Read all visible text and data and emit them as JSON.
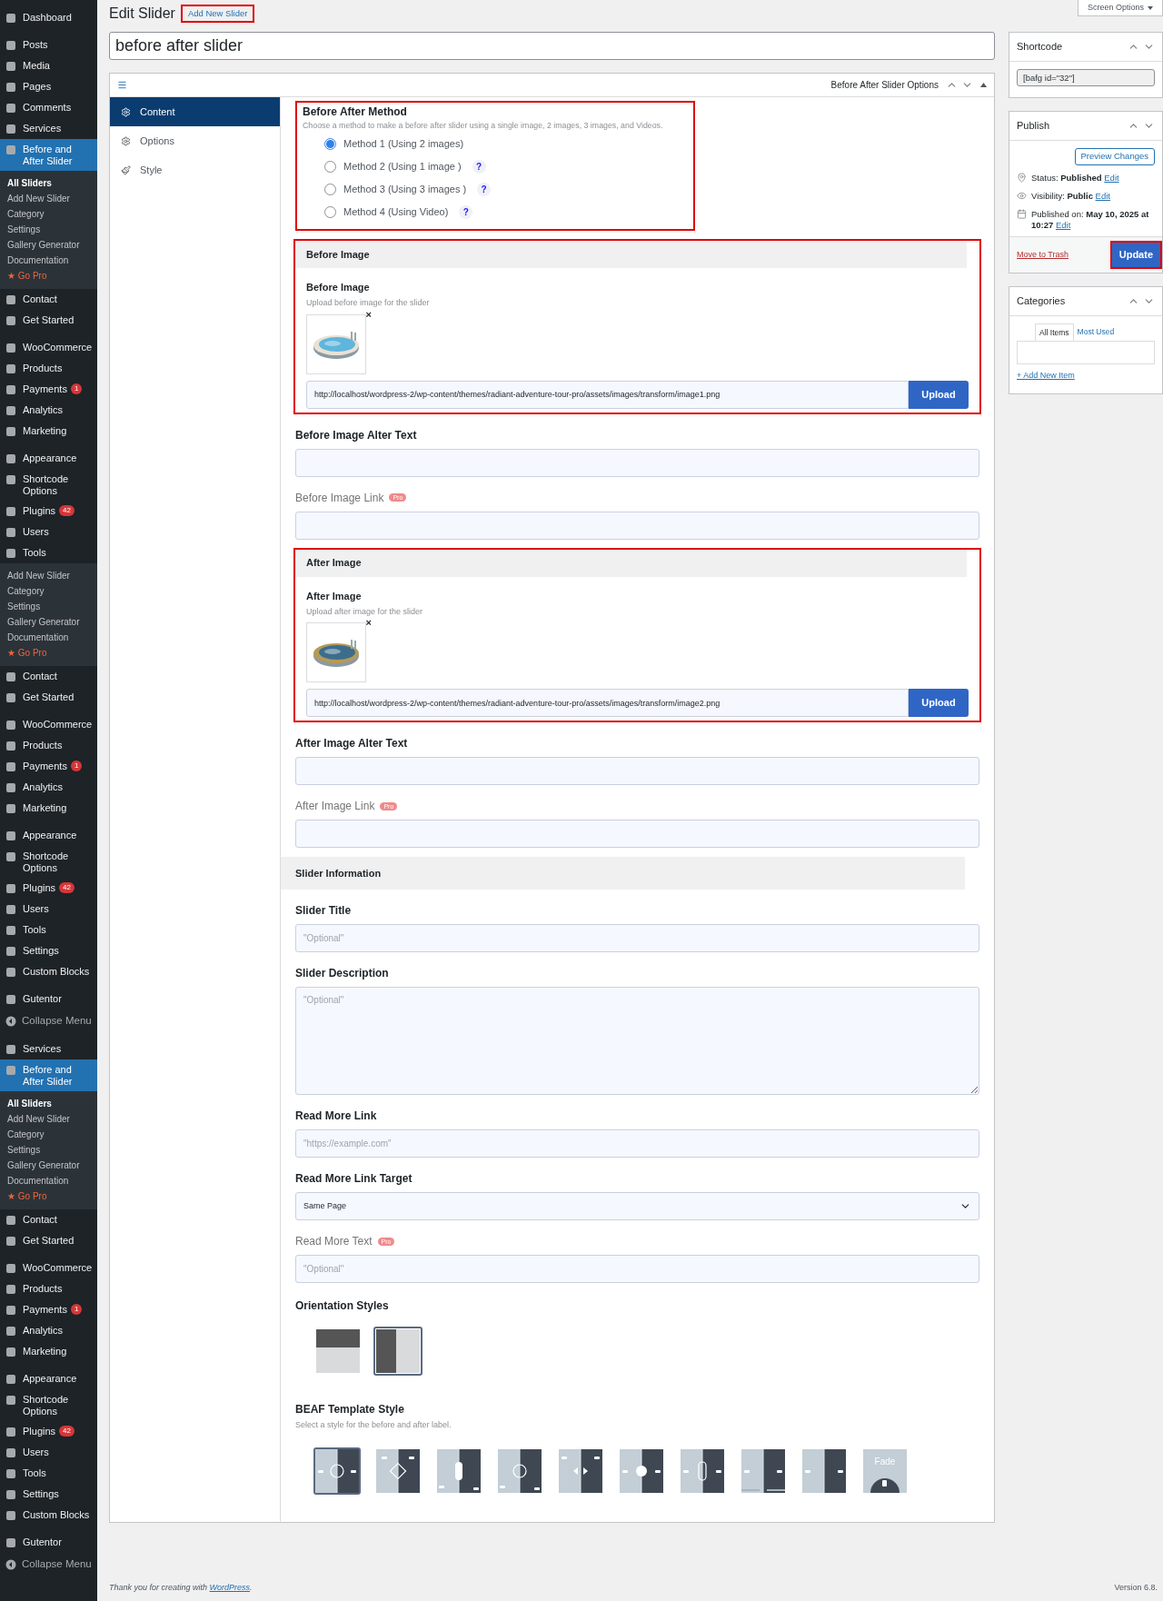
{
  "sidebar": {
    "items": [
      {
        "label": "Dashboard",
        "kind": "menu",
        "gap": false,
        "selected": false
      },
      {
        "label": "Posts",
        "kind": "menu",
        "gap": true,
        "selected": false
      },
      {
        "label": "Media",
        "kind": "menu",
        "gap": false,
        "selected": false
      },
      {
        "label": "Pages",
        "kind": "menu",
        "gap": false,
        "selected": false
      },
      {
        "label": "Comments",
        "kind": "menu",
        "gap": false,
        "selected": false
      },
      {
        "label": "Services",
        "kind": "menu",
        "gap": false,
        "selected": false
      },
      {
        "label": "Before and After Slider",
        "kind": "menu",
        "gap": false,
        "selected": true
      },
      {
        "label": "All Sliders",
        "kind": "sub",
        "gap": false,
        "selected": true
      },
      {
        "label": "Add New Slider",
        "kind": "sub",
        "gap": false,
        "selected": false
      },
      {
        "label": "Category",
        "kind": "sub",
        "gap": false,
        "selected": false
      },
      {
        "label": "Settings",
        "kind": "sub",
        "gap": false,
        "selected": false
      },
      {
        "label": "Gallery Generator",
        "kind": "sub",
        "gap": false,
        "selected": false
      },
      {
        "label": "Documentation",
        "kind": "sub",
        "gap": false,
        "selected": false
      },
      {
        "label": "★ Go Pro",
        "kind": "promo",
        "gap": false,
        "selected": false
      },
      {
        "label": "Contact",
        "kind": "menu",
        "gap": false,
        "selected": false
      },
      {
        "label": "Get Started",
        "kind": "menu",
        "gap": false,
        "selected": false
      },
      {
        "label": "WooCommerce",
        "kind": "menu",
        "gap": true,
        "selected": false
      },
      {
        "label": "Products",
        "kind": "menu",
        "gap": false,
        "selected": false
      },
      {
        "label": "Payments",
        "kind": "menu",
        "gap": false,
        "selected": false,
        "badge": "1"
      },
      {
        "label": "Analytics",
        "kind": "menu",
        "gap": false,
        "selected": false
      },
      {
        "label": "Marketing",
        "kind": "menu",
        "gap": false,
        "selected": false
      },
      {
        "label": "Appearance",
        "kind": "menu",
        "gap": true,
        "selected": false
      },
      {
        "label": "Shortcode Options",
        "kind": "menu",
        "gap": false,
        "selected": false
      },
      {
        "label": "Plugins",
        "kind": "menu",
        "gap": false,
        "selected": false,
        "badge": "42"
      },
      {
        "label": "Users",
        "kind": "menu",
        "gap": false,
        "selected": false
      },
      {
        "label": "Tools",
        "kind": "menu",
        "gap": false,
        "selected": false
      },
      {
        "label": "Add New Slider",
        "kind": "sub",
        "gap": false,
        "selected": false
      },
      {
        "label": "Category",
        "kind": "sub",
        "gap": false,
        "selected": false
      },
      {
        "label": "Settings",
        "kind": "sub",
        "gap": false,
        "selected": false
      },
      {
        "label": "Gallery Generator",
        "kind": "sub",
        "gap": false,
        "selected": false
      },
      {
        "label": "Documentation",
        "kind": "sub",
        "gap": false,
        "selected": false
      },
      {
        "label": "★ Go Pro",
        "kind": "promo",
        "gap": false,
        "selected": false
      },
      {
        "label": "Contact",
        "kind": "menu",
        "gap": false,
        "selected": false
      },
      {
        "label": "Get Started",
        "kind": "menu",
        "gap": false,
        "selected": false
      },
      {
        "label": "WooCommerce",
        "kind": "menu",
        "gap": true,
        "selected": false
      },
      {
        "label": "Products",
        "kind": "menu",
        "gap": false,
        "selected": false
      },
      {
        "label": "Payments",
        "kind": "menu",
        "gap": false,
        "selected": false,
        "badge": "1"
      },
      {
        "label": "Analytics",
        "kind": "menu",
        "gap": false,
        "selected": false
      },
      {
        "label": "Marketing",
        "kind": "menu",
        "gap": false,
        "selected": false
      },
      {
        "label": "Appearance",
        "kind": "menu",
        "gap": true,
        "selected": false
      },
      {
        "label": "Shortcode Options",
        "kind": "menu",
        "gap": false,
        "selected": false
      },
      {
        "label": "Plugins",
        "kind": "menu",
        "gap": false,
        "selected": false,
        "badge": "42"
      },
      {
        "label": "Users",
        "kind": "menu",
        "gap": false,
        "selected": false
      },
      {
        "label": "Tools",
        "kind": "menu",
        "gap": false,
        "selected": false
      },
      {
        "label": "Settings",
        "kind": "menu",
        "gap": false,
        "selected": false
      },
      {
        "label": "Custom Blocks",
        "kind": "menu",
        "gap": false,
        "selected": false
      },
      {
        "label": "Gutentor",
        "kind": "menu",
        "gap": true,
        "selected": false
      },
      {
        "label": "Collapse Menu",
        "kind": "collapse",
        "gap": false,
        "selected": false
      },
      {
        "label": "Services",
        "kind": "menu",
        "gap": true,
        "selected": false
      },
      {
        "label": "Before and After Slider",
        "kind": "menu",
        "gap": false,
        "selected": true
      },
      {
        "label": "All Sliders",
        "kind": "sub",
        "gap": false,
        "selected": true
      },
      {
        "label": "Add New Slider",
        "kind": "sub",
        "gap": false,
        "selected": false
      },
      {
        "label": "Category",
        "kind": "sub",
        "gap": false,
        "selected": false
      },
      {
        "label": "Settings",
        "kind": "sub",
        "gap": false,
        "selected": false
      },
      {
        "label": "Gallery Generator",
        "kind": "sub",
        "gap": false,
        "selected": false
      },
      {
        "label": "Documentation",
        "kind": "sub",
        "gap": false,
        "selected": false
      },
      {
        "label": "★ Go Pro",
        "kind": "promo",
        "gap": false,
        "selected": false
      },
      {
        "label": "Contact",
        "kind": "menu",
        "gap": false,
        "selected": false
      },
      {
        "label": "Get Started",
        "kind": "menu",
        "gap": false,
        "selected": false
      },
      {
        "label": "WooCommerce",
        "kind": "menu",
        "gap": true,
        "selected": false
      },
      {
        "label": "Products",
        "kind": "menu",
        "gap": false,
        "selected": false
      },
      {
        "label": "Payments",
        "kind": "menu",
        "gap": false,
        "selected": false,
        "badge": "1"
      },
      {
        "label": "Analytics",
        "kind": "menu",
        "gap": false,
        "selected": false
      },
      {
        "label": "Marketing",
        "kind": "menu",
        "gap": false,
        "selected": false
      },
      {
        "label": "Appearance",
        "kind": "menu",
        "gap": true,
        "selected": false
      },
      {
        "label": "Shortcode Options",
        "kind": "menu",
        "gap": false,
        "selected": false
      },
      {
        "label": "Plugins",
        "kind": "menu",
        "gap": false,
        "selected": false,
        "badge": "42"
      },
      {
        "label": "Users",
        "kind": "menu",
        "gap": false,
        "selected": false
      },
      {
        "label": "Tools",
        "kind": "menu",
        "gap": false,
        "selected": false
      },
      {
        "label": "Settings",
        "kind": "menu",
        "gap": false,
        "selected": false
      },
      {
        "label": "Custom Blocks",
        "kind": "menu",
        "gap": false,
        "selected": false
      },
      {
        "label": "Gutentor",
        "kind": "menu",
        "gap": true,
        "selected": false
      },
      {
        "label": "Collapse Menu",
        "kind": "collapse",
        "gap": false,
        "selected": false
      }
    ]
  },
  "page": {
    "title": "Edit Slider",
    "add_new": {
      "label": "Add New Slider",
      "highlighted": true
    },
    "post_title": "before after slider",
    "screen_options": "Screen Options"
  },
  "metabox": {
    "title": "Before After Slider Options",
    "tabs": [
      {
        "label": "Content",
        "kind": "content",
        "selected": true
      },
      {
        "label": "Options",
        "kind": "options",
        "selected": false
      },
      {
        "label": "Style",
        "kind": "style",
        "selected": false
      }
    ],
    "fields": [
      {
        "kind": "radio_group",
        "label": "Before After Method",
        "description": "Choose a method to make a before after slider using a single image, 2 images, 3 images, and Videos.",
        "highlighted": true,
        "options": [
          {
            "label": "Method 1 (Using 2 images)",
            "selected": true
          },
          {
            "label": "Method 2 (Using 1 image )",
            "selected": false,
            "help": "?"
          },
          {
            "label": "Method 3 (Using 3 images )",
            "selected": false,
            "help": "?"
          },
          {
            "label": "Method 4 (Using Video)",
            "selected": false,
            "help": "?"
          }
        ]
      },
      {
        "header": "Before Image",
        "label": "Before Image",
        "description": "Upload before image for the slider",
        "remove": "×",
        "value": "http://localhost/wordpress-2/wp-content/themes/radiant-adventure-tour-pro/assets/images/transform/image1.png",
        "button": "Upload",
        "highlighted": true
      },
      {
        "kind": "text",
        "label": "Before Image Alter Text",
        "disabled": false
      },
      {
        "kind": "text",
        "label": "Before Image Link",
        "pro": "Pro",
        "disabled": true
      },
      {
        "header": "After Image",
        "label": "After Image",
        "description": "Upload after image for the slider",
        "remove": "×",
        "value": "http://localhost/wordpress-2/wp-content/themes/radiant-adventure-tour-pro/assets/images/transform/image2.png",
        "button": "Upload",
        "highlighted": true
      },
      {
        "kind": "text",
        "label": "After Image Alter Text",
        "disabled": false
      },
      {
        "kind": "text",
        "label": "After Image Link",
        "pro": "Pro",
        "disabled": true
      },
      {
        "kind": "header",
        "label": "Slider Information"
      },
      {
        "kind": "text",
        "label": "Slider Title",
        "placeholder": "\"Optional\"",
        "disabled": false
      },
      {
        "kind": "textarea",
        "label": "Slider Description",
        "placeholder": "\"Optional\""
      },
      {
        "kind": "text",
        "label": "Read More Link",
        "placeholder": "\"https://example.com\"",
        "disabled": false
      },
      {
        "kind": "select",
        "label": "Read More Link Target",
        "value": "Same Page"
      },
      {
        "kind": "text",
        "label": "Read More Text",
        "pro": "Pro",
        "placeholder": "\"Optional\"",
        "disabled": true
      },
      {
        "kind": "orientation",
        "label": "Orientation Styles",
        "options": [
          {
            "kind": "horizontal",
            "selected": false
          },
          {
            "kind": "vertical",
            "selected": true
          }
        ]
      },
      {
        "kind": "templates",
        "label": "BEAF Template Style",
        "description": "Select a style for the before and after label.",
        "options": [
          {
            "kind": "circle",
            "selected": true
          },
          {
            "kind": "diamond",
            "selected": false
          },
          {
            "kind": "pill",
            "selected": false
          },
          {
            "kind": "circle-low",
            "selected": false
          },
          {
            "kind": "arrows",
            "selected": false
          },
          {
            "kind": "dot",
            "selected": false
          },
          {
            "kind": "pill-outline",
            "selected": false
          },
          {
            "kind": "bars",
            "selected": false
          },
          {
            "kind": "plain",
            "selected": false
          },
          {
            "kind": "fade",
            "label": "Fade",
            "selected": false
          }
        ]
      }
    ]
  },
  "shortcode": {
    "title": "Shortcode",
    "value": "[bafg id=\"32\"]"
  },
  "publish": {
    "title": "Publish",
    "preview": "Preview Changes",
    "status": {
      "label": "Status:",
      "value": "Published",
      "link": "Edit"
    },
    "visibility": {
      "label": "Visibility:",
      "value": "Public",
      "link": "Edit"
    },
    "published_on": {
      "label": "Published on:",
      "value": "May 10, 2025 at 10:27",
      "link": "Edit"
    },
    "trash": "Move to Trash",
    "update": {
      "label": "Update",
      "highlighted": true
    }
  },
  "categories": {
    "title": "Categories",
    "tabs": [
      {
        "label": "All Items",
        "selected": true
      },
      {
        "label": "Most Used",
        "selected": false
      }
    ],
    "add": "+ Add New Item"
  },
  "footer": {
    "text": "Thank you for creating with ",
    "link": "WordPress",
    "after": ".",
    "version": "Version 6.8."
  }
}
